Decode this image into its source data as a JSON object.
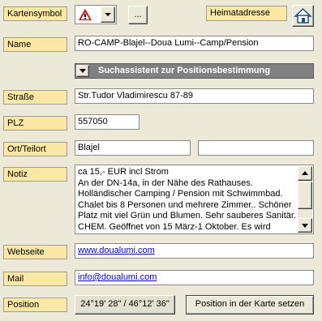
{
  "labels": {
    "kartensymbol": "Kartensymbol",
    "name": "Name",
    "strasse": "Straße",
    "plz": "PLZ",
    "ort": "Ort/Teilort",
    "notiz": "Notiz",
    "webseite": "Webseite",
    "mail": "Mail",
    "position": "Position",
    "heimatadresse": "Heimatadresse"
  },
  "symbol": {
    "browse_label": "..."
  },
  "name_value": "RO-CAMP-Blajel--Doua Lumi--Camp/Pension",
  "assistant_label": "Suchassistent zur Positionsbestimmung",
  "strasse_value": "Str.Tudor Vladimirescu 87-89",
  "plz_value": "557050",
  "ort_value": "Blajel",
  "teilort_value": "",
  "notiz_lines": [
    "ca 15,- EUR incl Strom",
    "An der DN-14a,  in der Nähe des Rathauses.",
    "Holländischer Camping / Pension mit Schwimmbad.",
    "Chalet bis 8 Personen und mehrere Zimmer.. Schöner",
    "Platz mit viel Grün und Blumen. Sehr sauberes Sanitär.",
    "CHEM. Geöffnet von 15 März-1 Oktober. Es wird"
  ],
  "webseite_value": "www.doualumi.com",
  "mail_value": "info@doualumi.com",
  "position_value": "24°19' 28\" / 46°12' 36\"",
  "set_position_label": "Position in der Karte setzen"
}
